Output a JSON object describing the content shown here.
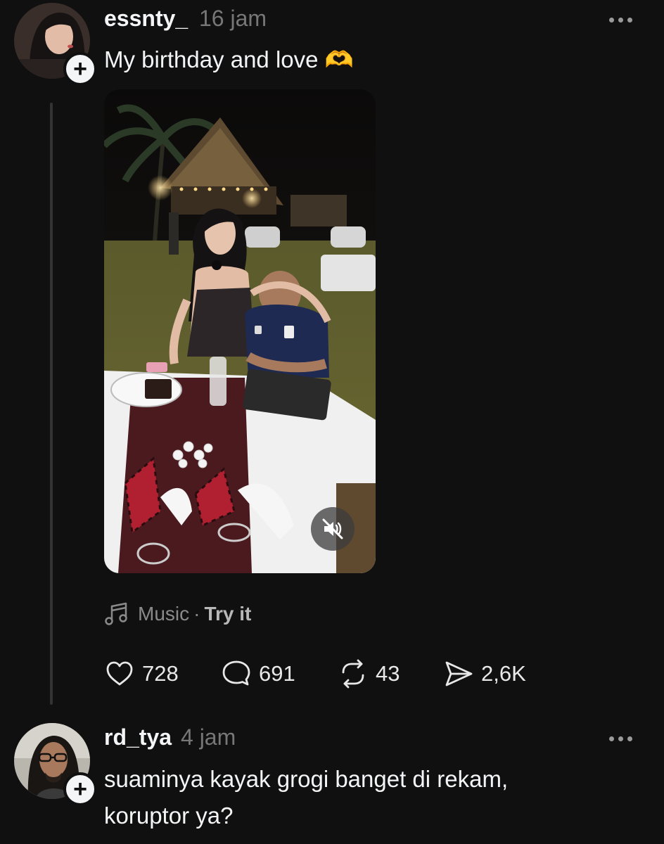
{
  "post": {
    "username": "essnty_",
    "time": "16 jam",
    "text": "My birthday and love 🫶",
    "music": {
      "label": "Music",
      "separator": "·",
      "action": "Try it"
    },
    "stats": {
      "likes": "728",
      "comments": "691",
      "reposts": "43",
      "shares": "2,6K"
    },
    "icons": {
      "like": "heart-icon",
      "comment": "comment-bubble-icon",
      "repost": "repost-icon",
      "share": "send-icon",
      "music": "music-note-icon",
      "mute": "speaker-muted-icon",
      "more": "more-horizontal-icon",
      "follow": "plus-icon"
    }
  },
  "reply": {
    "username": "rd_tya",
    "time": "4 jam",
    "text_line1": "suaminya kayak grogi banget di rekam,",
    "text_line2": "koruptor ya?"
  },
  "colors": {
    "background": "#101010",
    "primary_text": "#f3f5f7",
    "secondary_text": "#777777",
    "thread_line": "#333333"
  }
}
